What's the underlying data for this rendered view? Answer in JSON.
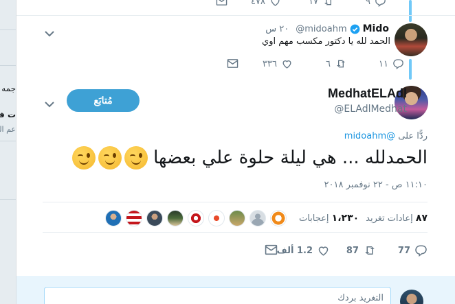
{
  "background": {
    "fragments": [
      "جمه",
      "ت في",
      "عم التنـ"
    ]
  },
  "top_tweet": {
    "actions": {
      "reply_count": "٩",
      "retweet_count": "١٧",
      "like_count": "٤٧٨"
    }
  },
  "reply_tweet": {
    "name": "Mido",
    "handle": "@midoahm",
    "time": "٢٠ س",
    "text": "الحمد لله يا دكتور مكسب مهم اوي",
    "actions": {
      "reply_count": "١١",
      "retweet_count": "٦",
      "like_count": "٣٣٦"
    }
  },
  "main_tweet": {
    "name": "MedhatELAdl",
    "handle": "@ELAdlMedhat",
    "follow_label": "مُتابَع",
    "replying_prefix": "ردًّا على",
    "replying_to": "@midoahm",
    "text": "الحمدلله ... هي ليلة حلوة علي بعضها",
    "timestamp": "١١:١٠ ص - ٢٢ نوفمبر ٢٠١٨",
    "stats": {
      "retweets_num": "٨٧",
      "retweets_label": "إعادات تغريد",
      "likes_num": "١،٢٣٠",
      "likes_label": "إعجابات"
    },
    "actions": {
      "reply_count": "77",
      "retweet_count": "87",
      "like_count": "1.2 ألف"
    }
  },
  "composer": {
    "placeholder": "التغريد بردك"
  },
  "colors": {
    "accent": "#1da1f2",
    "follow_button": "#3ea1d5",
    "muted": "#657786",
    "thread_line": "#71c9f8"
  }
}
